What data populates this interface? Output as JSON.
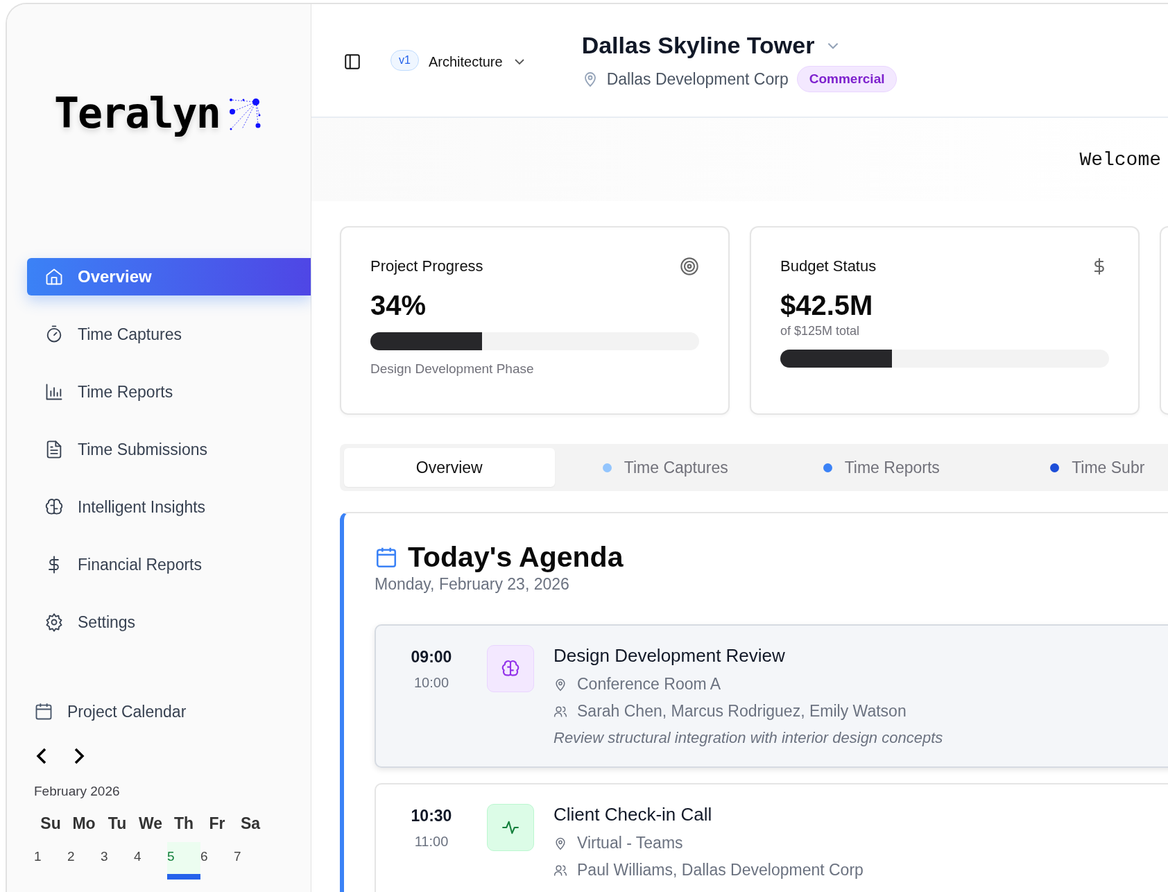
{
  "sidebar": {
    "logo": "Teralyn",
    "nav": [
      {
        "label": "Overview",
        "kind": "home",
        "selected": true
      },
      {
        "label": "Time Captures",
        "kind": "timer",
        "selected": false
      },
      {
        "label": "Time Reports",
        "kind": "chart",
        "selected": false
      },
      {
        "label": "Time Submissions",
        "kind": "file",
        "selected": false
      },
      {
        "label": "Intelligent Insights",
        "kind": "brain",
        "selected": false
      },
      {
        "label": "Financial Reports",
        "kind": "dollar",
        "selected": false
      },
      {
        "label": "Settings",
        "kind": "gear",
        "selected": false
      }
    ],
    "calendar": {
      "title": "Project Calendar",
      "month": "February 2026",
      "weekdays": [
        "Su",
        "Mo",
        "Tu",
        "We",
        "Th",
        "Fr",
        "Sa"
      ],
      "days": [
        {
          "label": "1",
          "selected": false
        },
        {
          "label": "2",
          "selected": false
        },
        {
          "label": "3",
          "selected": false
        },
        {
          "label": "4",
          "selected": false
        },
        {
          "label": "5",
          "selected": true
        },
        {
          "label": "6",
          "selected": false
        },
        {
          "label": "7",
          "selected": false
        }
      ]
    }
  },
  "header": {
    "version": "v1",
    "discipline": "Architecture",
    "project": "Dallas Skyline Tower",
    "client": "Dallas Development Corp",
    "tag": "Commercial"
  },
  "welcome": "Welcome",
  "cards": [
    {
      "title": "Project Progress",
      "kind": "target",
      "value": "34%",
      "level": 0.34,
      "caption": "Design Development Phase"
    },
    {
      "title": "Budget Status",
      "kind": "dollar",
      "value": "$42.5M",
      "subvalue": "of $125M total",
      "level": 0.34
    }
  ],
  "tabs": [
    {
      "label": "Overview",
      "selected": true
    },
    {
      "label": "Time Captures",
      "selected": false,
      "color": "#93c5fd"
    },
    {
      "label": "Time Reports",
      "selected": false,
      "color": "#3b82f6"
    },
    {
      "label": "Time Subr",
      "selected": false,
      "color": "#1d4ed8"
    }
  ],
  "agenda": {
    "title": "Today's Agenda",
    "date": "Monday, February 23, 2026",
    "events": [
      {
        "start": "09:00",
        "end": "10:00",
        "kind": "brain",
        "selected": true,
        "title": "Design Development Review",
        "location": "Conference Room A",
        "attendees": "Sarah Chen, Marcus Rodriguez, Emily Watson",
        "note": "Review structural integration with interior design concepts"
      },
      {
        "start": "10:30",
        "end": "11:00",
        "kind": "pulse",
        "selected": false,
        "title": "Client Check-in Call",
        "location": "Virtual - Teams",
        "attendees": "Paul Williams, Dallas Development Corp"
      }
    ]
  }
}
